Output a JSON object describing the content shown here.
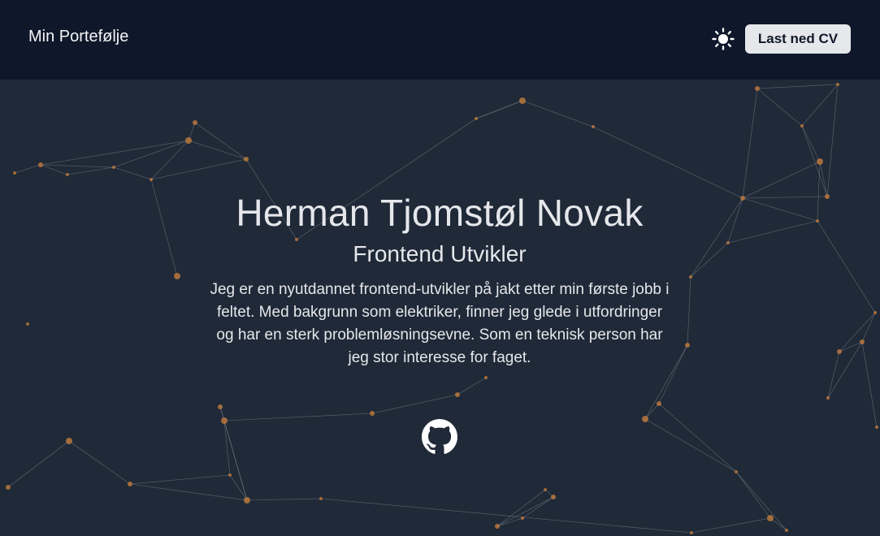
{
  "nav": {
    "brand": "Min Portefølje",
    "theme_icon": "sun-icon",
    "cv_button": "Last ned CV"
  },
  "hero": {
    "name": "Herman Tjomstøl Novak",
    "role": "Frontend Utvikler",
    "bio": "Jeg er en nyutdannet frontend-utvikler på jakt etter min første jobb i feltet. Med bakgrunn som elektriker, finner jeg glede i utfordringer og har en sterk problemløsningsevne. Som en teknisk person har jeg stor interesse for faget.",
    "github_icon": "github-icon"
  },
  "colors": {
    "nav_background": "#0f172a",
    "hero_background": "#1f2937",
    "text": "#e5e7eb",
    "button_background": "#e5e7eb",
    "node_color": "#b8773c",
    "link_color": "#7a7f86"
  }
}
